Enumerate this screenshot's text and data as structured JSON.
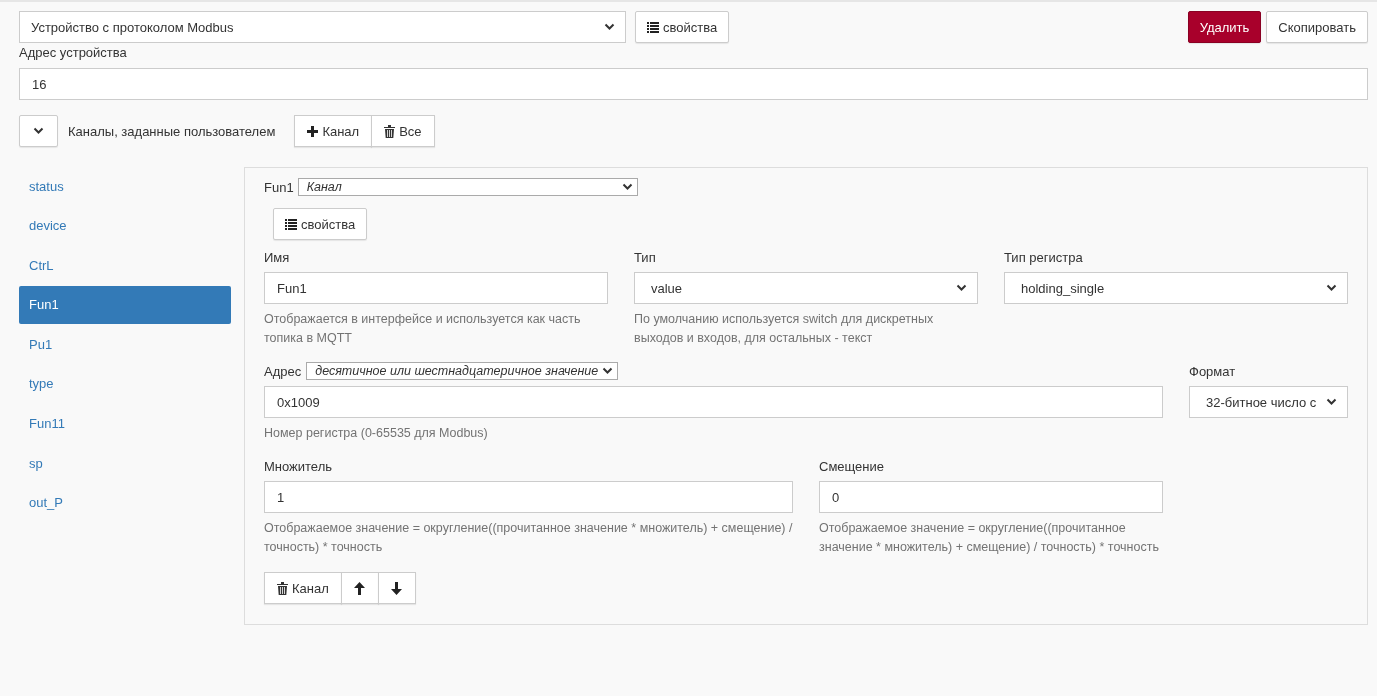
{
  "device_select": {
    "value": "Устройство с протоколом Modbus"
  },
  "properties_button": "свойства",
  "actions": [
    {
      "label": "Удалить",
      "kind": "danger"
    },
    {
      "label": "Скопировать",
      "kind": "default"
    }
  ],
  "device_address": {
    "label": "Адрес устройства",
    "value": "16"
  },
  "channels_header": {
    "title": "Каналы, заданные пользователем",
    "add_button": "Канал",
    "delete_all_button": "Все"
  },
  "channels": [
    {
      "name": "status",
      "selected": false
    },
    {
      "name": "device",
      "selected": false
    },
    {
      "name": "CtrL",
      "selected": false
    },
    {
      "name": "Fun1",
      "selected": true
    },
    {
      "name": "Pu1",
      "selected": false
    },
    {
      "name": "type",
      "selected": false
    },
    {
      "name": "Fun11",
      "selected": false
    },
    {
      "name": "sp",
      "selected": false
    },
    {
      "name": "out_P",
      "selected": false
    }
  ],
  "editor": {
    "name": "Fun1",
    "type_select": "Канал",
    "properties_button": "свойства",
    "rows": [
      [
        {
          "label": "Имя",
          "kind": "text",
          "value": "Fun1",
          "help": "Отображается в интерфейсе и используется как часть топика в MQTT"
        },
        {
          "label": "Тип",
          "kind": "select",
          "value": "value",
          "help": "По умолчанию используется switch для дискретных выходов и входов, для остальных - текст"
        },
        {
          "label": "Тип регистра",
          "kind": "select",
          "value": "holding_single"
        }
      ],
      [
        {
          "label": "Адрес",
          "mode": "десятичное или шестнадцатеричное значение",
          "kind": "text",
          "value": "0x1009",
          "help": "Номер регистра (0-65535 для Modbus)"
        },
        {
          "label": "Формат",
          "kind": "select",
          "value": "32-битное число с"
        }
      ],
      [
        {
          "label": "Множитель",
          "kind": "text",
          "value": "1",
          "help": "Отображаемое значение = округление((прочитанное значение * множитель) + смещение) / точность) * точность"
        },
        {
          "label": "Смещение",
          "kind": "text",
          "value": "0",
          "help": "Отображаемое значение = округление((прочитанное значение * множитель) + смещение) / точность) * точность"
        }
      ]
    ],
    "delete_button": "Канал"
  }
}
